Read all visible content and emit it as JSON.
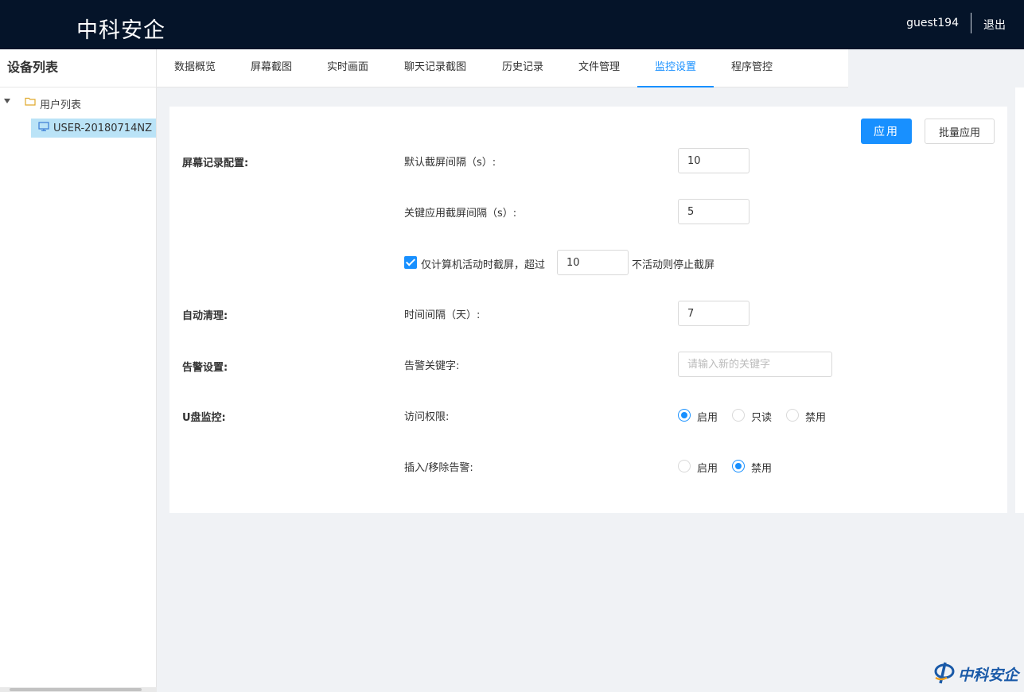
{
  "header": {
    "brand": "中科安企",
    "username": "guest194",
    "logout_label": "退出"
  },
  "sidebar": {
    "title": "设备列表",
    "tree": {
      "root_label": "用户列表",
      "children": [
        {
          "label": "USER-20180714NZ",
          "selected": true
        }
      ]
    }
  },
  "tabs": [
    {
      "label": "数据概览",
      "active": false
    },
    {
      "label": "屏幕截图",
      "active": false
    },
    {
      "label": "实时画面",
      "active": false
    },
    {
      "label": "聊天记录截图",
      "active": false
    },
    {
      "label": "历史记录",
      "active": false
    },
    {
      "label": "文件管理",
      "active": false
    },
    {
      "label": "监控设置",
      "active": true
    },
    {
      "label": "程序管控",
      "active": false
    }
  ],
  "actions": {
    "apply_label": "应用",
    "batch_apply_label": "批量应用"
  },
  "settings": {
    "screen_record": {
      "section_label": "屏幕记录配置:",
      "default_interval_label": "默认截屏间隔（s）:",
      "default_interval_value": "10",
      "key_app_interval_label": "关键应用截屏间隔（s）:",
      "key_app_interval_value": "5",
      "active_only_checked": true,
      "active_only_prefix": "仅计算机活动时截屏，超过",
      "inactive_threshold_value": "10",
      "active_only_suffix": "不活动则停止截屏"
    },
    "auto_clean": {
      "section_label": "自动清理:",
      "interval_label": "时间间隔（天）:",
      "interval_value": "7"
    },
    "alert": {
      "section_label": "告警设置:",
      "keyword_label": "告警关键字:",
      "keyword_value": "",
      "keyword_placeholder": "请输入新的关键字"
    },
    "usb": {
      "section_label": "U盘监控:",
      "access_label": "访问权限:",
      "access_options": [
        "启用",
        "只读",
        "禁用"
      ],
      "access_selected": "启用",
      "plug_alert_label": "插入/移除告警:",
      "plug_alert_options": [
        "启用",
        "禁用"
      ],
      "plug_alert_selected": "禁用"
    }
  },
  "watermark": {
    "text": "中科安企"
  },
  "colors": {
    "header_bg": "#051429",
    "accent": "#1890ff",
    "selected_node_bg": "#bae3f7",
    "page_bg": "#f0f2f5"
  }
}
